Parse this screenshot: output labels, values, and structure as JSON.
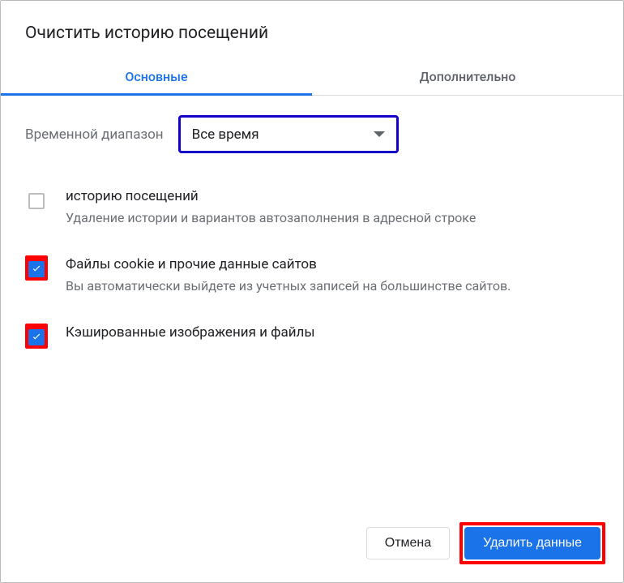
{
  "dialog": {
    "title": "Очистить историю посещений",
    "tabs": {
      "basic": "Основные",
      "advanced": "Дополнительно"
    },
    "timerange": {
      "label": "Временной диапазон",
      "value": "Все время"
    },
    "options": [
      {
        "checked": false,
        "highlighted": false,
        "title": "историю посещений",
        "description": "Удаление истории и вариантов автозаполнения в адресной строке"
      },
      {
        "checked": true,
        "highlighted": true,
        "title": "Файлы cookie и прочие данные сайтов",
        "description": "Вы автоматически выйдете из учетных записей на большинстве сайтов."
      },
      {
        "checked": true,
        "highlighted": true,
        "title": "Кэшированные изображения и файлы",
        "description": ""
      }
    ],
    "buttons": {
      "cancel": "Отмена",
      "confirm": "Удалить данные"
    }
  }
}
